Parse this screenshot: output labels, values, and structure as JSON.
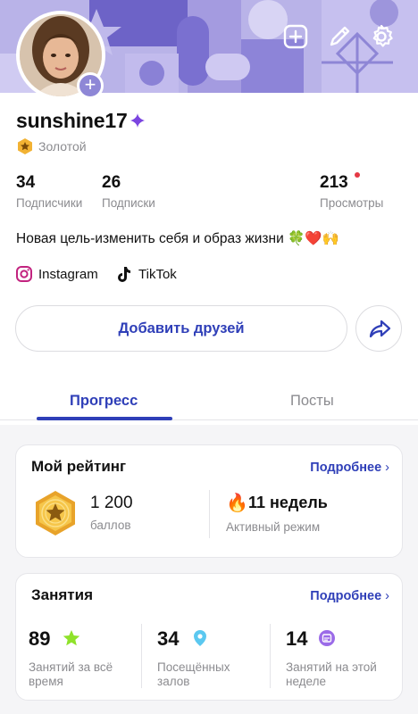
{
  "profile": {
    "username": "sunshine17",
    "badge_label": "Золотой",
    "bio": "Новая цель-изменить себя и образ жизни 🍀❤️🙌"
  },
  "stats": [
    {
      "value": "34",
      "label": "Подписчики"
    },
    {
      "value": "26",
      "label": "Подписки"
    },
    {
      "value": "213",
      "label": "Просмотры"
    }
  ],
  "social": [
    {
      "label": "Instagram",
      "icon": "instagram-icon"
    },
    {
      "label": "TikTok",
      "icon": "tiktok-icon"
    }
  ],
  "actions": {
    "add_friends_label": "Добавить друзей"
  },
  "tabs": [
    {
      "label": "Прогресс",
      "active": true
    },
    {
      "label": "Посты",
      "active": false
    }
  ],
  "rating_card": {
    "title": "Мой рейтинг",
    "more_label": "Подробнее",
    "points_value": "1 200",
    "points_label": "баллов",
    "weeks_value": "11 недель",
    "weeks_label": "Активный режим"
  },
  "classes_card": {
    "title": "Занятия",
    "more_label": "Подробнее",
    "items": [
      {
        "value": "89",
        "label": "Занятий за всё время",
        "icon": "star-icon"
      },
      {
        "value": "34",
        "label": "Посещённых залов",
        "icon": "location-pin-icon"
      },
      {
        "value": "14",
        "label": "Занятий на этой неделе",
        "icon": "calendar-icon"
      }
    ]
  },
  "colors": {
    "accent": "#2f3fb8",
    "banner": "#b7b0e6",
    "muted": "#8b8b8f",
    "notification": "#e53944"
  }
}
